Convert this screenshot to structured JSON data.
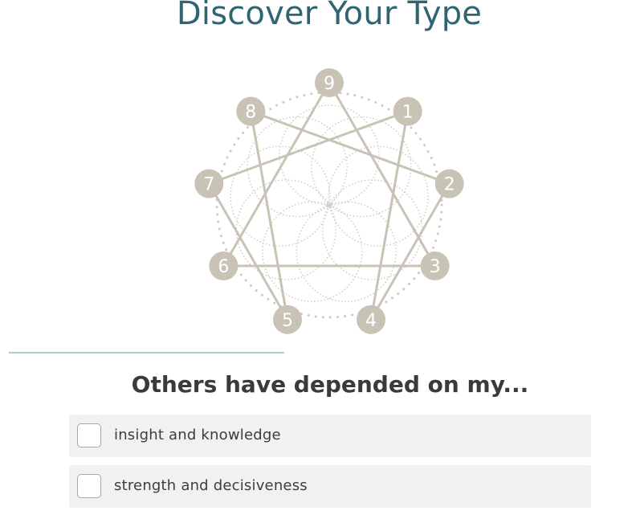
{
  "page": {
    "title": "Discover Your Type"
  },
  "enneagram": {
    "numbers": [
      "9",
      "1",
      "2",
      "3",
      "4",
      "5",
      "6",
      "7",
      "8"
    ],
    "colors": {
      "node": "#c9c3b6",
      "line": "#c9c3b6",
      "dots": "#cfcbc4"
    }
  },
  "progress": {
    "fraction": 0.43
  },
  "question": {
    "text": "Others have depended on my...",
    "options": [
      {
        "label": "insight and knowledge",
        "checked": false
      },
      {
        "label": "strength and decisiveness",
        "checked": false
      }
    ]
  },
  "colors": {
    "title": "#2f6473",
    "progress": "#a9d0cf",
    "option_bg": "#f1f1f1"
  }
}
